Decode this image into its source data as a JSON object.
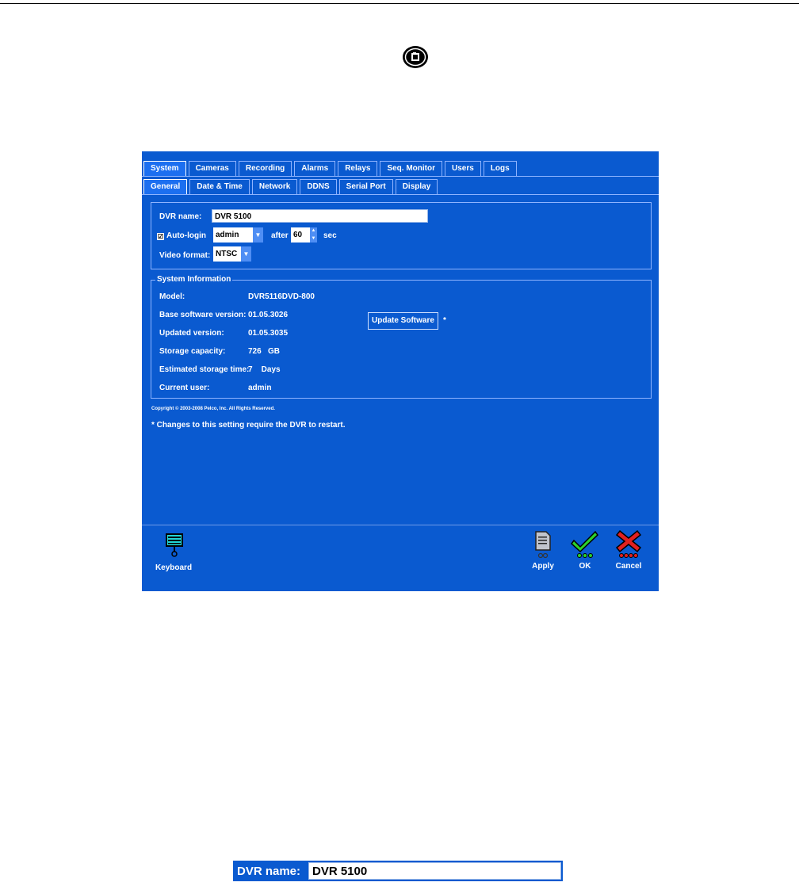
{
  "main_tabs": [
    {
      "label": "System",
      "active": true
    },
    {
      "label": "Cameras",
      "active": false
    },
    {
      "label": "Recording",
      "active": false
    },
    {
      "label": "Alarms",
      "active": false
    },
    {
      "label": "Relays",
      "active": false
    },
    {
      "label": "Seq. Monitor",
      "active": false
    },
    {
      "label": "Users",
      "active": false
    },
    {
      "label": "Logs",
      "active": false
    }
  ],
  "sub_tabs": [
    {
      "label": "General",
      "active": true
    },
    {
      "label": "Date & Time",
      "active": false
    },
    {
      "label": "Network",
      "active": false
    },
    {
      "label": "DDNS",
      "active": false
    },
    {
      "label": "Serial Port",
      "active": false
    },
    {
      "label": "Display",
      "active": false
    }
  ],
  "general": {
    "dvr_name_label": "DVR name:",
    "dvr_name_value": "DVR 5100",
    "auto_login_label": "Auto-login",
    "auto_login_checked": "☑",
    "auto_login_user": "admin",
    "after_label": "after",
    "after_value": "60",
    "sec_label": "sec",
    "video_format_label": "Video format:",
    "video_format_value": "NTSC"
  },
  "system_info": {
    "legend": "System Information",
    "rows": [
      {
        "label": "Model:",
        "value": "DVR5116DVD-800"
      },
      {
        "label": "Base software version:",
        "value": "01.05.3026"
      },
      {
        "label": "Updated version:",
        "value": "01.05.3035"
      },
      {
        "label": "Storage capacity:",
        "value": "726   GB"
      },
      {
        "label": "Estimated storage time:",
        "value": "7    Days"
      },
      {
        "label": "Current user:",
        "value": "admin"
      }
    ],
    "update_button": "Update Software",
    "update_asterisk": "*"
  },
  "copyright": "Copyright © 2003-2008 Pelco, Inc. All Rights Reserved.",
  "restart_note": "* Changes to this setting require the DVR to restart.",
  "toolbar": {
    "keyboard": "Keyboard",
    "apply": "Apply",
    "ok": "OK",
    "cancel": "Cancel"
  },
  "zoom": {
    "label": "DVR name:",
    "value": "DVR 5100"
  },
  "colors": {
    "window_bg": "#0a5ad0",
    "ok_green": "#2cd12c",
    "cancel_red": "#e02020"
  }
}
